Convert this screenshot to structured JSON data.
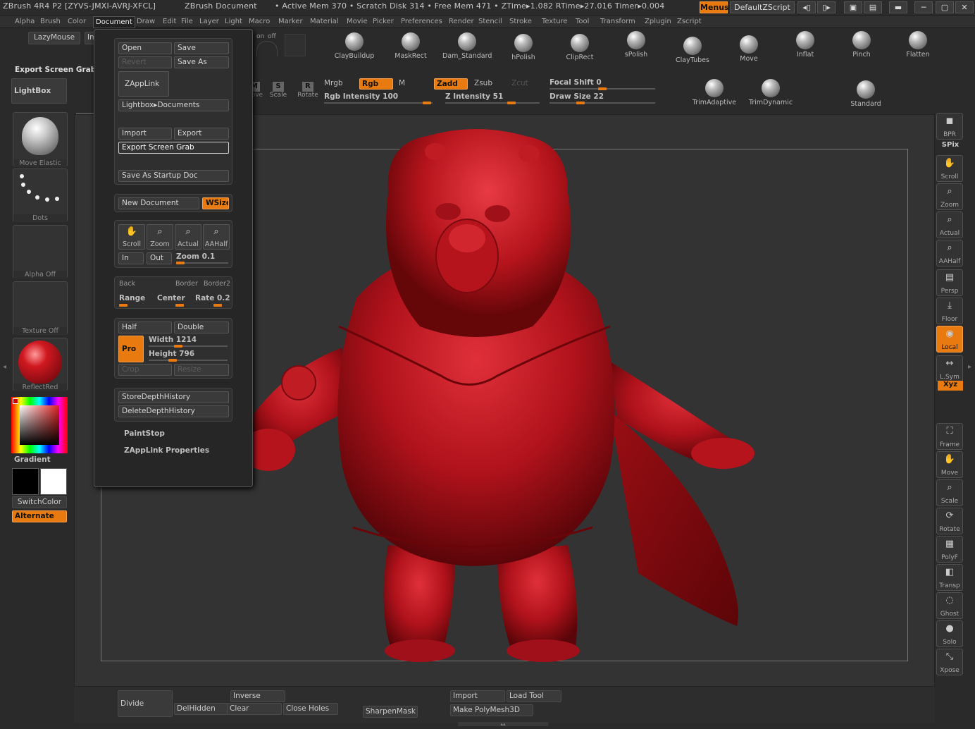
{
  "title": {
    "app": "ZBrush 4R4 P2 [ZYVS-JMXI-AVRJ-XFCL]",
    "doc": "ZBrush Document",
    "stats": "• Active Mem 370 • Scratch Disk 314 • Free Mem 471 • ZTime▸1.082 RTime▸27.016 Timer▸0.004",
    "menus_btn": "Menus",
    "script_btn": "DefaultZScript"
  },
  "menubar": [
    "Alpha",
    "Brush",
    "Color",
    "Document",
    "Draw",
    "Edit",
    "File",
    "Layer",
    "Light",
    "Macro",
    "Marker",
    "Material",
    "Movie",
    "Picker",
    "Preferences",
    "Render",
    "Stencil",
    "Stroke",
    "Texture",
    "Tool",
    "Transform",
    "Zplugin",
    "Zscript"
  ],
  "top": {
    "lazymouse": "LazyMouse",
    "import": "Import",
    "onoff_on": "on",
    "onoff_off": "off",
    "export_label": "Export Screen Grab",
    "lightbox": "LightBox"
  },
  "brushes": [
    "ClayBuildup",
    "MaskRect",
    "Dam_Standard",
    "hPolish",
    "ClipRect",
    "sPolish",
    "ClayTubes",
    "Move",
    "Inflat",
    "Pinch",
    "Flatten"
  ],
  "brushes2": [
    "TrimAdaptive",
    "TrimDynamic",
    "Standard"
  ],
  "toolbar": {
    "move": "Move",
    "scale": "Scale",
    "rotate": "Rotate",
    "mrgb": "Mrgb",
    "rgb": "Rgb",
    "m": "M",
    "zadd": "Zadd",
    "zsub": "Zsub",
    "zcut": "Zcut",
    "rgb_int": "Rgb Intensity 100",
    "z_int": "Z Intensity 51",
    "focal": "Focal Shift 0",
    "drawsize": "Draw Size 22"
  },
  "leftshelf": {
    "move_elastic": "Move Elastic",
    "dots": "Dots",
    "alpha_off": "Alpha Off",
    "texture_off": "Texture Off",
    "reflectred": "ReflectRed",
    "gradient": "Gradient",
    "switchcolor": "SwitchColor",
    "alternate": "Alternate"
  },
  "doc_menu": {
    "open": "Open",
    "save": "Save",
    "revert": "Revert",
    "save_as": "Save As",
    "zapplink": "ZAppLink",
    "lightbox_docs": "Lightbox▸Documents",
    "import": "Import",
    "export": "Export",
    "export_grab": "Export Screen Grab",
    "startup": "Save As Startup Doc",
    "new_doc": "New Document",
    "wsize": "WSize",
    "scroll": "Scroll",
    "zoom": "Zoom",
    "actual": "Actual",
    "aahalf": "AAHalf",
    "in": "In",
    "out": "Out",
    "zoom_val": "Zoom 0.1",
    "back": "Back",
    "border": "Border",
    "border2": "Border2",
    "range": "Range",
    "center": "Center",
    "rate": "Rate 0.2",
    "half": "Half",
    "double": "Double",
    "pro": "Pro",
    "width": "Width 1214",
    "height": "Height 796",
    "crop": "Crop",
    "resize": "Resize",
    "store": "StoreDepthHistory",
    "delete": "DeleteDepthHistory",
    "paintstop": "PaintStop",
    "zapp_props": "ZAppLink Properties"
  },
  "rightshelf": [
    "BPR",
    "SPix",
    "Scroll",
    "Zoom",
    "Actual",
    "AAHalf",
    "Persp",
    "Floor",
    "Local",
    "L.Sym",
    "Xyz",
    "Frame",
    "Move",
    "Scale",
    "Rotate",
    "PolyF",
    "Transp",
    "Ghost",
    "Solo",
    "Xpose"
  ],
  "bottom": {
    "divide": "Divide",
    "inverse": "Inverse",
    "delhidden": "DelHidden",
    "clear": "Clear",
    "closeholes": "Close Holes",
    "sharpenmask": "SharpenMask",
    "import": "Import",
    "loadtool": "Load Tool",
    "makepoly": "Make PolyMesh3D"
  },
  "colors": {
    "accent": "#e87a10",
    "model": "#b5141c"
  }
}
